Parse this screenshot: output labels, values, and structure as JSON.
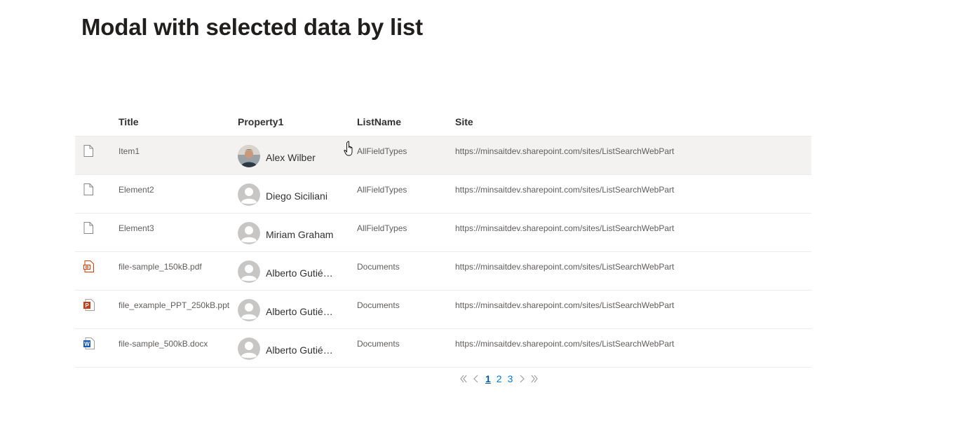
{
  "page": {
    "title": "Modal with selected data by list"
  },
  "columns": {
    "title": "Title",
    "property1": "Property1",
    "listname": "ListName",
    "site": "Site"
  },
  "rows": [
    {
      "icon": "document-icon",
      "title": "Item1",
      "person": "Alex Wilber",
      "avatar": "photo",
      "listname": "AllFieldTypes",
      "site": "https://minsaitdev.sharepoint.com/sites/ListSearchWebPart"
    },
    {
      "icon": "document-icon",
      "title": "Element2",
      "person": "Diego Siciliani",
      "avatar": "placeholder",
      "listname": "AllFieldTypes",
      "site": "https://minsaitdev.sharepoint.com/sites/ListSearchWebPart"
    },
    {
      "icon": "document-icon",
      "title": "Element3",
      "person": "Miriam Graham",
      "avatar": "placeholder",
      "listname": "AllFieldTypes",
      "site": "https://minsaitdev.sharepoint.com/sites/ListSearchWebPart"
    },
    {
      "icon": "pdf-file-icon",
      "title": "file-sample_150kB.pdf",
      "person": "Alberto Gutiérrez",
      "avatar": "placeholder",
      "listname": "Documents",
      "site": "https://minsaitdev.sharepoint.com/sites/ListSearchWebPart"
    },
    {
      "icon": "powerpoint-file-icon",
      "title": "file_example_PPT_250kB.ppt",
      "person": "Alberto Gutiérrez",
      "avatar": "placeholder",
      "listname": "Documents",
      "site": "https://minsaitdev.sharepoint.com/sites/ListSearchWebPart"
    },
    {
      "icon": "word-file-icon",
      "title": "file-sample_500kB.docx",
      "person": "Alberto Gutiérrez",
      "avatar": "placeholder",
      "listname": "Documents",
      "site": "https://minsaitdev.sharepoint.com/sites/ListSearchWebPart"
    }
  ],
  "pagination": {
    "first": "«",
    "prev": "‹",
    "next": "›",
    "last": "»",
    "pages": [
      "1",
      "2",
      "3"
    ],
    "current": "1"
  },
  "colors": {
    "selected_row": "#f3f2f1",
    "link": "#0078d4",
    "pdf": "#d83b01",
    "ppt": "#c43e1c",
    "word": "#185abd"
  }
}
